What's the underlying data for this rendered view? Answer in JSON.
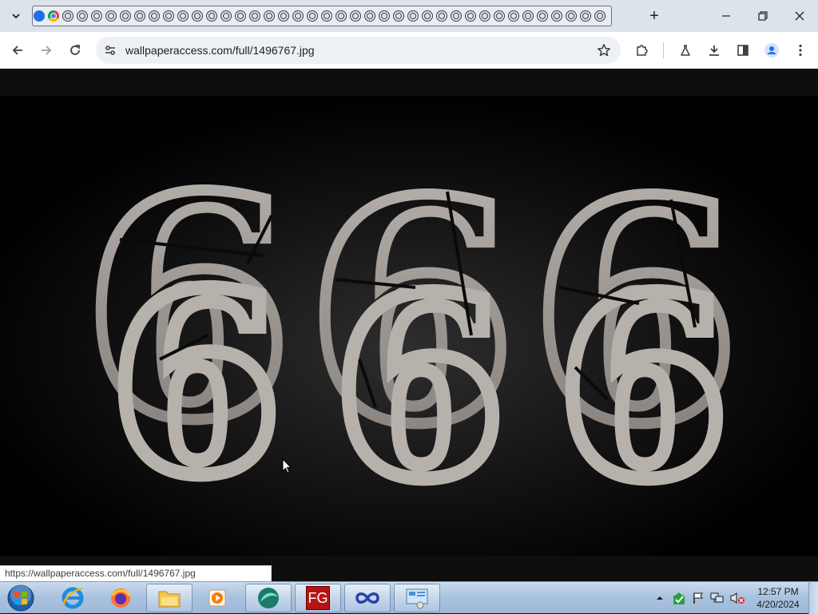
{
  "browser": {
    "tab_count_favicons": 40,
    "new_tab_label": "+",
    "address": "wallpaperaccess.com/full/1496767.jpg",
    "status_url": "https://wallpaperaccess.com/full/1496767.jpg"
  },
  "content": {
    "numerals": [
      "6",
      "6",
      "6"
    ]
  },
  "taskbar": {
    "apps": [
      "start-orb-icon",
      "internet-explorer-icon",
      "firefox-icon",
      "file-explorer-icon",
      "media-player-icon",
      "app-teal-icon",
      "fg-app-icon",
      "infinity-app-icon",
      "control-panel-icon"
    ],
    "fg_label": "FG",
    "clock_time": "12:57 PM",
    "clock_date": "4/20/2024"
  },
  "colors": {
    "tabstrip": "#dde3ea",
    "omnibox": "#edf1f6",
    "page_bg": "#0e0e0e",
    "taskbar": "#a8c2de"
  }
}
